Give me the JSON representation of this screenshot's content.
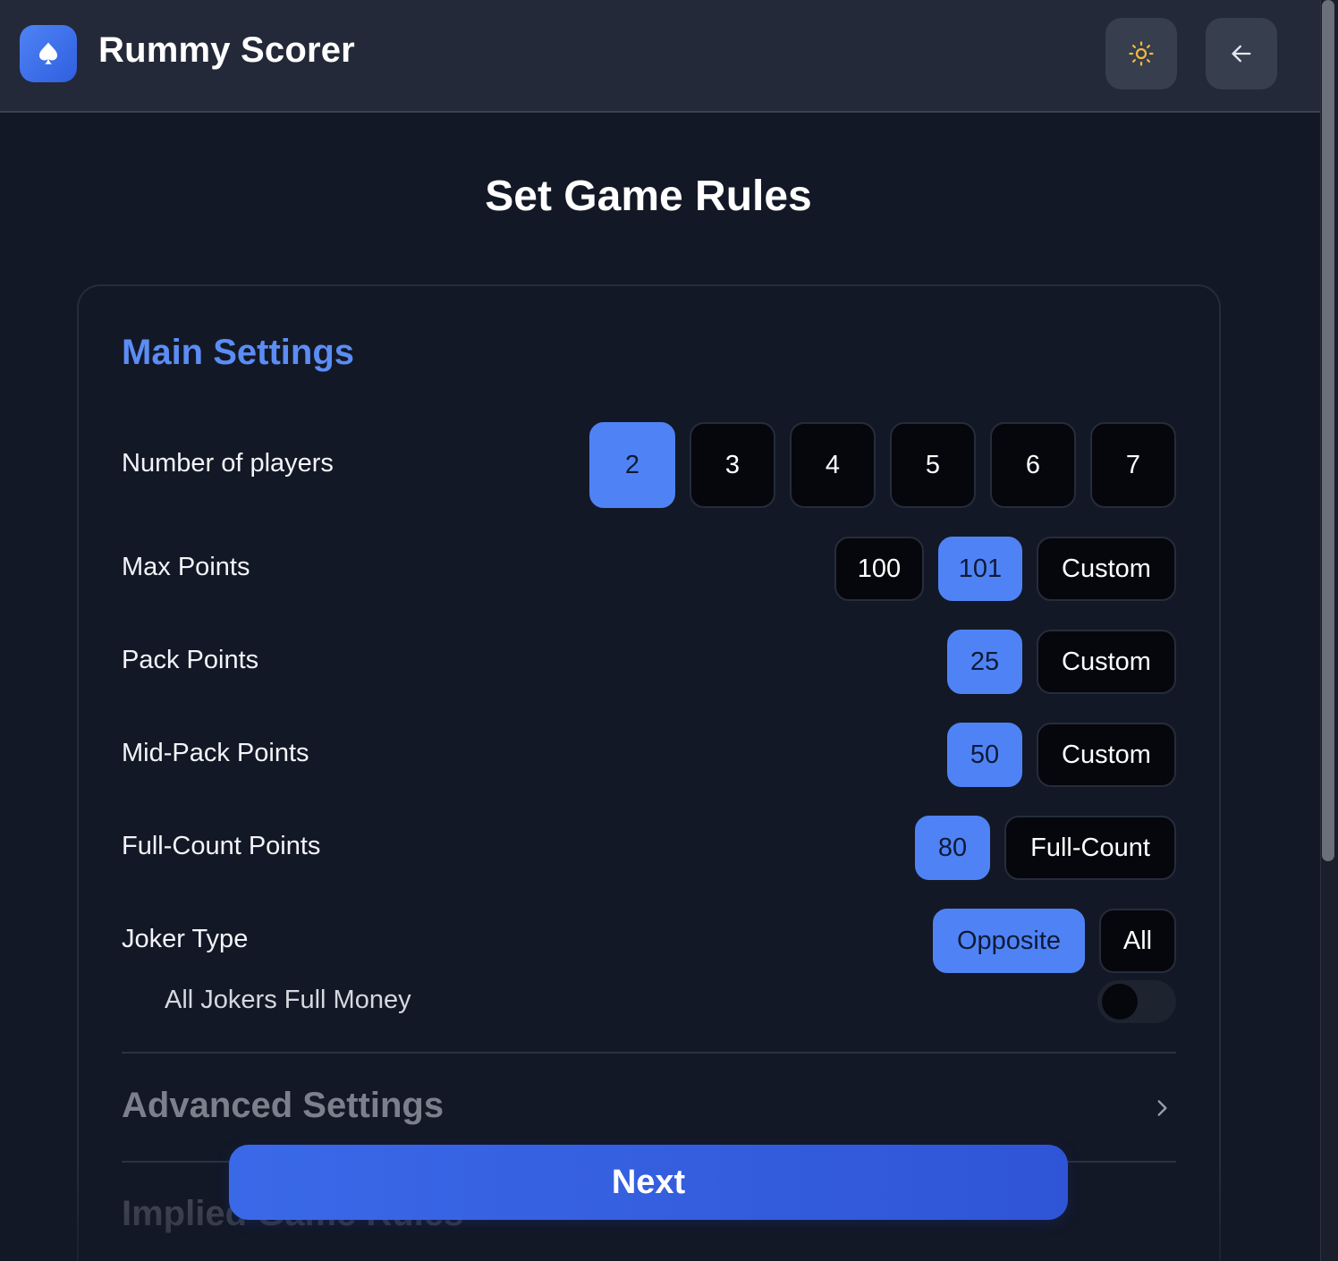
{
  "header": {
    "app_title": "Rummy Scorer"
  },
  "page": {
    "title": "Set Game Rules"
  },
  "main_settings": {
    "title": "Main Settings",
    "players": {
      "label": "Number of players",
      "options": [
        "2",
        "3",
        "4",
        "5",
        "6",
        "7"
      ],
      "selected": "2"
    },
    "max_points": {
      "label": "Max Points",
      "options": [
        "100",
        "101",
        "Custom"
      ],
      "selected": "101"
    },
    "pack_points": {
      "label": "Pack Points",
      "options": [
        "25",
        "Custom"
      ],
      "selected": "25"
    },
    "mid_pack_points": {
      "label": "Mid-Pack Points",
      "options": [
        "50",
        "Custom"
      ],
      "selected": "50"
    },
    "full_count_points": {
      "label": "Full-Count Points",
      "options": [
        "80",
        "Full-Count"
      ],
      "selected": "80"
    },
    "joker_type": {
      "label": "Joker Type",
      "options": [
        "Opposite",
        "All"
      ],
      "selected": "Opposite"
    },
    "all_jokers_full_money": {
      "label": "All Jokers Full Money",
      "enabled": false
    }
  },
  "advanced_settings": {
    "title": "Advanced Settings"
  },
  "implied_rules": {
    "title": "Implied Game Rules"
  },
  "footer": {
    "next_label": "Next"
  },
  "colors": {
    "accent": "#4f83f5",
    "background": "#131826",
    "header": "#232938",
    "chip_off": "#05070d",
    "sun_icon": "#f5b93a"
  }
}
